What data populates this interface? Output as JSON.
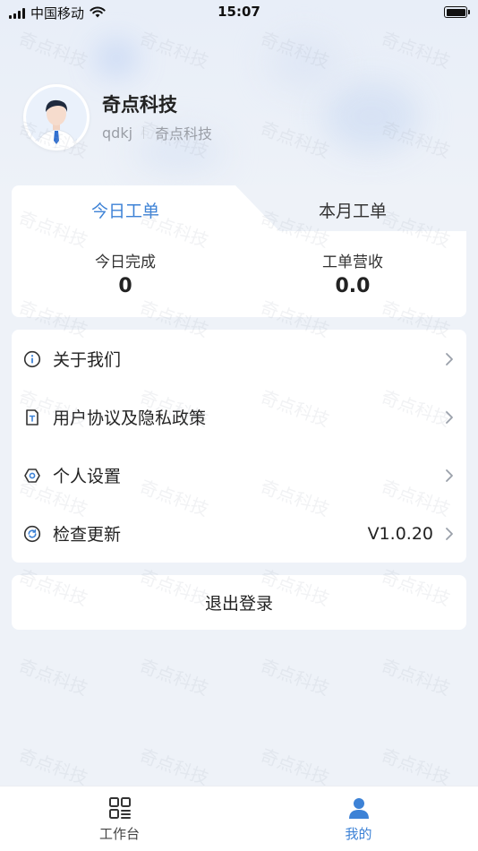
{
  "status_bar": {
    "carrier": "中国移动",
    "time": "15:07"
  },
  "watermark": {
    "text": "奇点科技"
  },
  "profile": {
    "name": "奇点科技",
    "username": "qdkj",
    "company": "奇点科技"
  },
  "work_orders": {
    "tabs": [
      {
        "label": "今日工单",
        "active": true
      },
      {
        "label": "本月工单",
        "active": false
      }
    ],
    "stats": [
      {
        "label": "今日完成",
        "value": "0"
      },
      {
        "label": "工单营收",
        "value": "0.0"
      }
    ]
  },
  "menu": {
    "items": [
      {
        "label": "关于我们",
        "icon": "info-icon"
      },
      {
        "label": "用户协议及隐私政策",
        "icon": "document-icon"
      },
      {
        "label": "个人设置",
        "icon": "settings-icon"
      },
      {
        "label": "检查更新",
        "icon": "refresh-icon",
        "value": "V1.0.20"
      }
    ]
  },
  "logout_label": "退出登录",
  "tabbar": {
    "items": [
      {
        "label": "工作台",
        "icon": "grid-icon",
        "active": false
      },
      {
        "label": "我的",
        "icon": "user-icon",
        "active": true
      }
    ]
  },
  "colors": {
    "accent": "#3d82d6",
    "background": "#eef2f8",
    "card": "#ffffff",
    "text": "#222222",
    "muted": "#9a9ea6"
  }
}
